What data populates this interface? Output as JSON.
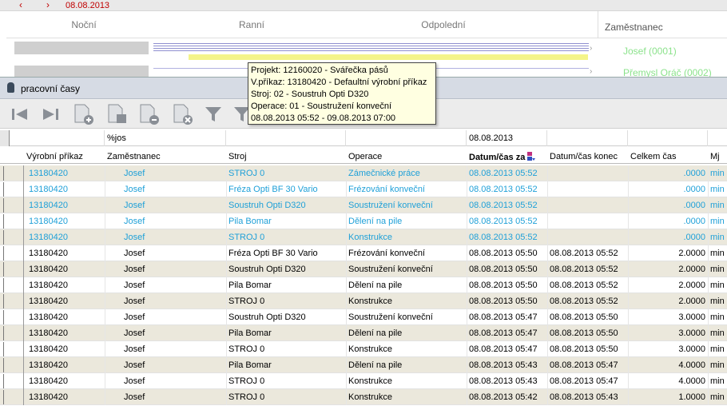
{
  "scheduler": {
    "date": "08.08.2013",
    "shifts": [
      "Noční",
      "Ranní",
      "Odpolední"
    ],
    "employee_header": "Zaměstnanec",
    "employees": [
      "Josef (0001)",
      "Přemysl Oráč (0002)"
    ]
  },
  "window": {
    "title": "pracovní časy"
  },
  "toolbar": {
    "buttons": [
      "first-icon",
      "last-icon",
      "insert-icon",
      "copy-icon",
      "delete-icon",
      "remove-icon",
      "filter-icon",
      "filter-clear-icon"
    ]
  },
  "tooltip": {
    "lines": [
      "Projekt: 12160020 - Svářečka pásů",
      "V.příkaz: 13180420 - Defaultní výrobní příkaz",
      "Stroj: 02 - Soustruh Opti D320",
      "Operace: 01 - Soustružení konveční",
      "08.08.2013 05:52 - 09.08.2013 07:00"
    ]
  },
  "grid": {
    "filter": {
      "employee": "%jos",
      "start": "08.08.2013"
    },
    "columns": [
      "Výrobní příkaz",
      "Zaměstnanec",
      "Stroj",
      "Operace",
      "Datum/čas začátek",
      "Datum/čas konec",
      "Celkem čas",
      "Mj"
    ],
    "sorted_column_label": "Datum/čas za",
    "rows": [
      {
        "order": "13180420",
        "employee": "Josef",
        "machine": "STROJ 0",
        "operation": "Zámečnické práce",
        "start": "08.08.2013 05:52",
        "end": "",
        "total": ".0000",
        "unit": "min",
        "state": "open"
      },
      {
        "order": "13180420",
        "employee": "Josef",
        "machine": "Fréza Opti BF 30 Vario",
        "operation": "Frézování konveční",
        "start": "08.08.2013 05:52",
        "end": "",
        "total": ".0000",
        "unit": "min",
        "state": "open"
      },
      {
        "order": "13180420",
        "employee": "Josef",
        "machine": "Soustruh Opti D320",
        "operation": "Soustružení konveční",
        "start": "08.08.2013 05:52",
        "end": "",
        "total": ".0000",
        "unit": "min",
        "state": "open"
      },
      {
        "order": "13180420",
        "employee": "Josef",
        "machine": "Pila Bomar",
        "operation": "Dělení na pile",
        "start": "08.08.2013 05:52",
        "end": "",
        "total": ".0000",
        "unit": "min",
        "state": "open"
      },
      {
        "order": "13180420",
        "employee": "Josef",
        "machine": "STROJ 0",
        "operation": "Konstrukce",
        "start": "08.08.2013 05:52",
        "end": "",
        "total": ".0000",
        "unit": "min",
        "state": "open"
      },
      {
        "order": "13180420",
        "employee": "Josef",
        "machine": "Fréza Opti BF 30 Vario",
        "operation": "Frézování konveční",
        "start": "08.08.2013 05:50",
        "end": "08.08.2013 05:52",
        "total": "2.0000",
        "unit": "min",
        "state": "closed"
      },
      {
        "order": "13180420",
        "employee": "Josef",
        "machine": "Soustruh Opti D320",
        "operation": "Soustružení konveční",
        "start": "08.08.2013 05:50",
        "end": "08.08.2013 05:52",
        "total": "2.0000",
        "unit": "min",
        "state": "closed"
      },
      {
        "order": "13180420",
        "employee": "Josef",
        "machine": "Pila Bomar",
        "operation": "Dělení na pile",
        "start": "08.08.2013 05:50",
        "end": "08.08.2013 05:52",
        "total": "2.0000",
        "unit": "min",
        "state": "closed"
      },
      {
        "order": "13180420",
        "employee": "Josef",
        "machine": "STROJ 0",
        "operation": "Konstrukce",
        "start": "08.08.2013 05:50",
        "end": "08.08.2013 05:52",
        "total": "2.0000",
        "unit": "min",
        "state": "closed"
      },
      {
        "order": "13180420",
        "employee": "Josef",
        "machine": "Soustruh Opti D320",
        "operation": "Soustružení konveční",
        "start": "08.08.2013 05:47",
        "end": "08.08.2013 05:50",
        "total": "3.0000",
        "unit": "min",
        "state": "closed"
      },
      {
        "order": "13180420",
        "employee": "Josef",
        "machine": "Pila Bomar",
        "operation": "Dělení na pile",
        "start": "08.08.2013 05:47",
        "end": "08.08.2013 05:50",
        "total": "3.0000",
        "unit": "min",
        "state": "closed"
      },
      {
        "order": "13180420",
        "employee": "Josef",
        "machine": "STROJ 0",
        "operation": "Konstrukce",
        "start": "08.08.2013 05:47",
        "end": "08.08.2013 05:50",
        "total": "3.0000",
        "unit": "min",
        "state": "closed"
      },
      {
        "order": "13180420",
        "employee": "Josef",
        "machine": "Pila Bomar",
        "operation": "Dělení na pile",
        "start": "08.08.2013 05:43",
        "end": "08.08.2013 05:47",
        "total": "4.0000",
        "unit": "min",
        "state": "closed"
      },
      {
        "order": "13180420",
        "employee": "Josef",
        "machine": "STROJ 0",
        "operation": "Konstrukce",
        "start": "08.08.2013 05:43",
        "end": "08.08.2013 05:47",
        "total": "4.0000",
        "unit": "min",
        "state": "closed"
      },
      {
        "order": "13180420",
        "employee": "Josef",
        "machine": "STROJ 0",
        "operation": "Konstrukce",
        "start": "08.08.2013 05:42",
        "end": "08.08.2013 05:43",
        "total": "1.0000",
        "unit": "min",
        "state": "closed"
      }
    ]
  },
  "colors": {
    "open_row_text": "#1fa0d8",
    "alt_row_bg": "#ebe8dc",
    "date_red": "#c00000",
    "employee_green": "#8be28b"
  }
}
